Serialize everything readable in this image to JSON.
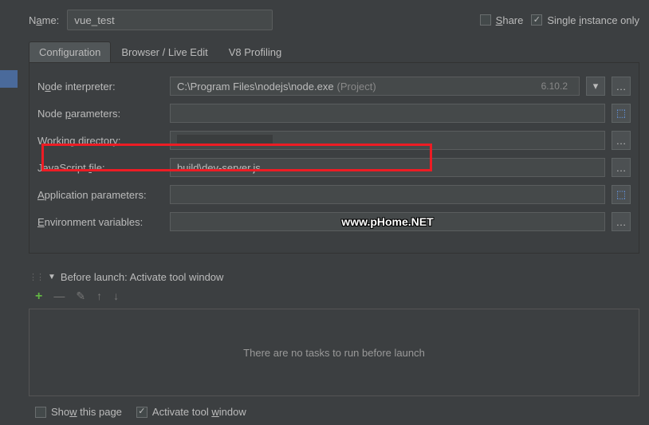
{
  "top": {
    "name_label_pre": "N",
    "name_label_u": "a",
    "name_label_post": "me:",
    "name_value": "vue_test",
    "share_u": "S",
    "share_post": "hare",
    "single_pre": "Single ",
    "single_u": "i",
    "single_post": "nstance only"
  },
  "tabs": {
    "configuration": "Configuration",
    "browser": "Browser / Live Edit",
    "v8": "V8 Profiling"
  },
  "rows": {
    "node_interpreter": {
      "pre": "N",
      "u": "o",
      "post": "de interpreter:",
      "value": "C:\\Program Files\\nodejs\\node.exe",
      "hint": "(Project)",
      "version": "6.10.2"
    },
    "node_params": {
      "pre": "Node ",
      "u": "p",
      "post": "arameters:",
      "value": ""
    },
    "working_dir": {
      "pre": "Working ",
      "u": "d",
      "post": "irectory:",
      "value": ""
    },
    "js_file": {
      "pre": "JavaScript ",
      "u": "f",
      "post": "ile:",
      "value": "build\\dev-server.js"
    },
    "app_params": {
      "u": "A",
      "post": "pplication parameters:",
      "value": ""
    },
    "env_vars": {
      "u": "E",
      "post": "nvironment variables:",
      "value": ""
    }
  },
  "watermark": "www.pHome.NET",
  "beforeLaunch": {
    "title": "Before launch: Activate tool window",
    "empty": "There are no tasks to run before launch",
    "show_pre": "Sho",
    "show_u": "w",
    "show_post": " this page",
    "activate_pre": "Activate tool ",
    "activate_u": "w",
    "activate_post": "indow"
  }
}
